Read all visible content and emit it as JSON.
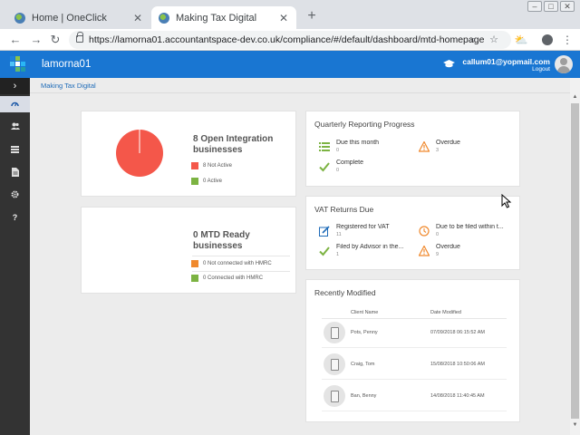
{
  "browser": {
    "tabs": [
      {
        "title": "Home | OneClick",
        "active": false
      },
      {
        "title": "Making Tax Digital",
        "active": true
      }
    ],
    "url": "https://lamorna01.accountantspace-dev.co.uk/compliance/#/default/dashboard/mtd-homepage",
    "new_tab_symbol": "+",
    "close_symbol": "✕"
  },
  "app": {
    "name": "lamorna01",
    "user_email": "callum01@yopmail.com",
    "logout_label": "Logout",
    "brand_color": "#1976d2",
    "breadcrumb": "Making Tax Digital"
  },
  "sidebar": {
    "toggle_icon": "chevron-right-icon",
    "items": [
      {
        "icon": "dashboard-icon",
        "active": true
      },
      {
        "icon": "users-icon",
        "active": false
      },
      {
        "icon": "list-icon",
        "active": false
      },
      {
        "icon": "document-icon",
        "active": false
      },
      {
        "icon": "gear-icon",
        "active": false
      },
      {
        "icon": "help-icon",
        "active": false
      }
    ]
  },
  "integration": {
    "title": "8 Open Integration businesses",
    "legend": [
      {
        "label": "8 Not Active",
        "color": "#f4574a"
      },
      {
        "label": "0 Active",
        "color": "#7cb342"
      }
    ]
  },
  "mtd_ready": {
    "title": "0 MTD Ready businesses",
    "legend": [
      {
        "label": "0 Not connected with HMRC",
        "color": "#f0892d"
      },
      {
        "label": "0 Connected with HMRC",
        "color": "#7cb342"
      }
    ]
  },
  "quarterly": {
    "title": "Quarterly Reporting Progress",
    "items": [
      {
        "label": "Due this month",
        "value": "0",
        "icon": "list-icon"
      },
      {
        "label": "Overdue",
        "value": "3",
        "icon": "warning-icon"
      },
      {
        "label": "Complete",
        "value": "0",
        "icon": "check-icon"
      }
    ]
  },
  "vat_returns": {
    "title": "VAT Returns Due",
    "items": [
      {
        "label": "Registered for VAT",
        "value": "11",
        "icon": "edit-icon"
      },
      {
        "label": "Due to be filed within t...",
        "value": "0",
        "icon": "clock-icon"
      },
      {
        "label": "Filed by Advisor in the...",
        "value": "1",
        "icon": "check-icon"
      },
      {
        "label": "Overdue",
        "value": "9",
        "icon": "warning-icon"
      }
    ]
  },
  "recent": {
    "title": "Recently Modified",
    "columns": [
      "Client Name",
      "Date Modified"
    ],
    "rows": [
      {
        "client": "Pots, Penny",
        "date": "07/09/2018 06:15:52 AM"
      },
      {
        "client": "Craig, Tom",
        "date": "15/08/2018 10:50:06 AM"
      },
      {
        "client": "Ban, Benny",
        "date": "14/08/2018 11:40:45 AM"
      }
    ]
  }
}
